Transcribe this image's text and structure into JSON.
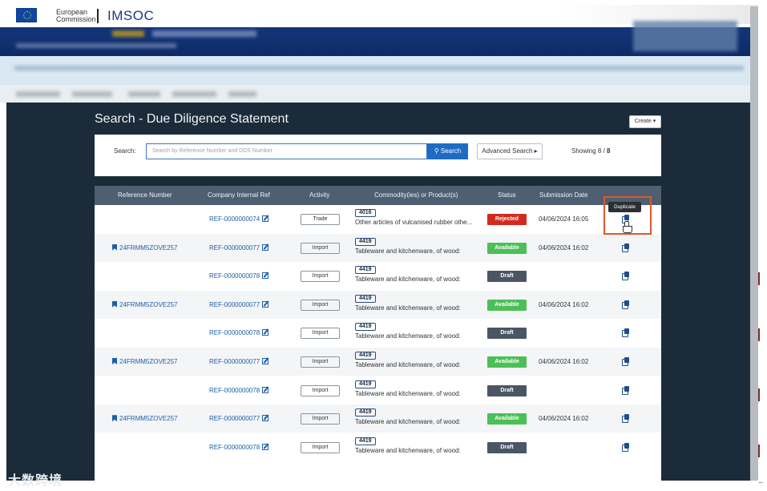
{
  "header": {
    "org_line1": "European",
    "org_line2": "Commission",
    "app_name": "IMSOC"
  },
  "page": {
    "title": "Search - Due Diligence Statement",
    "create_label": "Create ▾"
  },
  "search": {
    "label": "Search:",
    "placeholder": "Search by Reference Number and DDS Number",
    "button_label": "Search",
    "advanced_label": "Advanced Search ▸",
    "showing_prefix": "Showing 8 / ",
    "showing_total": "8"
  },
  "table": {
    "headers": [
      "Reference Number",
      "Company Internal Ref",
      "Activity",
      "Commodity(ies) or Product(s)",
      "Status",
      "Submission Date"
    ],
    "rows": [
      {
        "ref": "",
        "internal_ref": "REF-0000000074",
        "activity": "Trade",
        "hs": "4016",
        "product": "Other articles of vulcanised rubber othe...",
        "status": "Rejected",
        "date": "04/06/2024 16:05"
      },
      {
        "ref": "24FRMM5ZOVE257",
        "internal_ref": "REF-0000000077",
        "activity": "Import",
        "hs": "4419",
        "product": "Tableware and kitchenware, of wood:",
        "status": "Available",
        "date": "04/06/2024 16:02"
      },
      {
        "ref": "",
        "internal_ref": "REF-0000000078",
        "activity": "Import",
        "hs": "4419",
        "product": "Tableware and kitchenware, of wood:",
        "status": "Draft",
        "date": ""
      },
      {
        "ref": "24FRMM5ZOVE257",
        "internal_ref": "REF-0000000077",
        "activity": "Import",
        "hs": "4419",
        "product": "Tableware and kitchenware, of wood:",
        "status": "Available",
        "date": "04/06/2024 16:02"
      },
      {
        "ref": "",
        "internal_ref": "REF-0000000078",
        "activity": "Import",
        "hs": "4419",
        "product": "Tableware and kitchenware, of wood:",
        "status": "Draft",
        "date": ""
      },
      {
        "ref": "24FRMM5ZOVE257",
        "internal_ref": "REF-0000000077",
        "activity": "Import",
        "hs": "4419",
        "product": "Tableware and kitchenware, of wood:",
        "status": "Available",
        "date": "04/06/2024 16:02"
      },
      {
        "ref": "",
        "internal_ref": "REF-0000000078",
        "activity": "Import",
        "hs": "4419",
        "product": "Tableware and kitchenware, of wood:",
        "status": "Draft",
        "date": ""
      },
      {
        "ref": "24FRMM5ZOVE257",
        "internal_ref": "REF-0000000077",
        "activity": "Import",
        "hs": "4419",
        "product": "Tableware and kitchenware, of wood:",
        "status": "Available",
        "date": "04/06/2024 16:02"
      },
      {
        "ref": "",
        "internal_ref": "REF-0000000078",
        "activity": "Import",
        "hs": "4419",
        "product": "Tableware and kitchenware, of wood:",
        "status": "Draft",
        "date": ""
      }
    ]
  },
  "tooltip": {
    "label": "Duplicate"
  },
  "watermark": {
    "text": "大数跨境"
  },
  "colors": {
    "header_blue": "#13367a",
    "backdrop": "#1b2b3a",
    "rejected": "#d32a1e",
    "available": "#4cbf56",
    "draft": "#4a5663",
    "link": "#1e5fa8",
    "highlight": "#e2572c"
  }
}
